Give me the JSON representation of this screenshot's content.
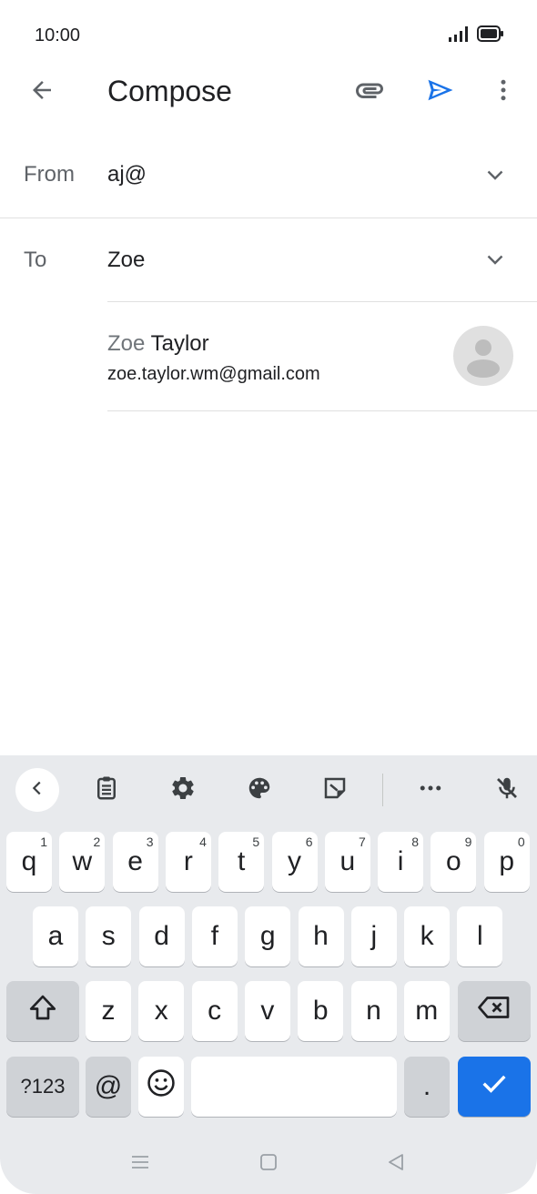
{
  "status": {
    "time": "10:00",
    "icons": [
      "signal-icon",
      "battery-icon"
    ]
  },
  "app_bar": {
    "title": "Compose",
    "icons": [
      "back-arrow-icon",
      "attach-icon",
      "send-icon",
      "more-vert-icon"
    ]
  },
  "from": {
    "label": "From",
    "value": "aj@"
  },
  "to": {
    "label": "To",
    "value": "Zoe"
  },
  "suggestion": {
    "name_match": "Zoe",
    "name_rest": " Taylor",
    "email": "zoe.taylor.wm@gmail.com"
  },
  "keyboard": {
    "toolbar": [
      "chevron-left-icon",
      "clipboard-icon",
      "gear-icon",
      "palette-icon",
      "sticker-icon",
      "more-horiz-icon",
      "mic-off-icon"
    ],
    "row1": [
      {
        "key": "q",
        "hint": "1"
      },
      {
        "key": "w",
        "hint": "2"
      },
      {
        "key": "e",
        "hint": "3"
      },
      {
        "key": "r",
        "hint": "4"
      },
      {
        "key": "t",
        "hint": "5"
      },
      {
        "key": "y",
        "hint": "6"
      },
      {
        "key": "u",
        "hint": "7"
      },
      {
        "key": "i",
        "hint": "8"
      },
      {
        "key": "o",
        "hint": "9"
      },
      {
        "key": "p",
        "hint": "0"
      }
    ],
    "row2": [
      "a",
      "s",
      "d",
      "f",
      "g",
      "h",
      "j",
      "k",
      "l"
    ],
    "row3": [
      "z",
      "x",
      "c",
      "v",
      "b",
      "n",
      "m"
    ],
    "symbols_label": "?123",
    "at_label": "@",
    "period_label": "."
  },
  "colors": {
    "accent": "#1a73e8",
    "keyboard_bg": "#e8eaed",
    "modifier_key": "#cfd2d6"
  },
  "nav": {
    "icons": [
      "recent-apps-icon",
      "home-icon",
      "back-triangle-icon"
    ]
  }
}
